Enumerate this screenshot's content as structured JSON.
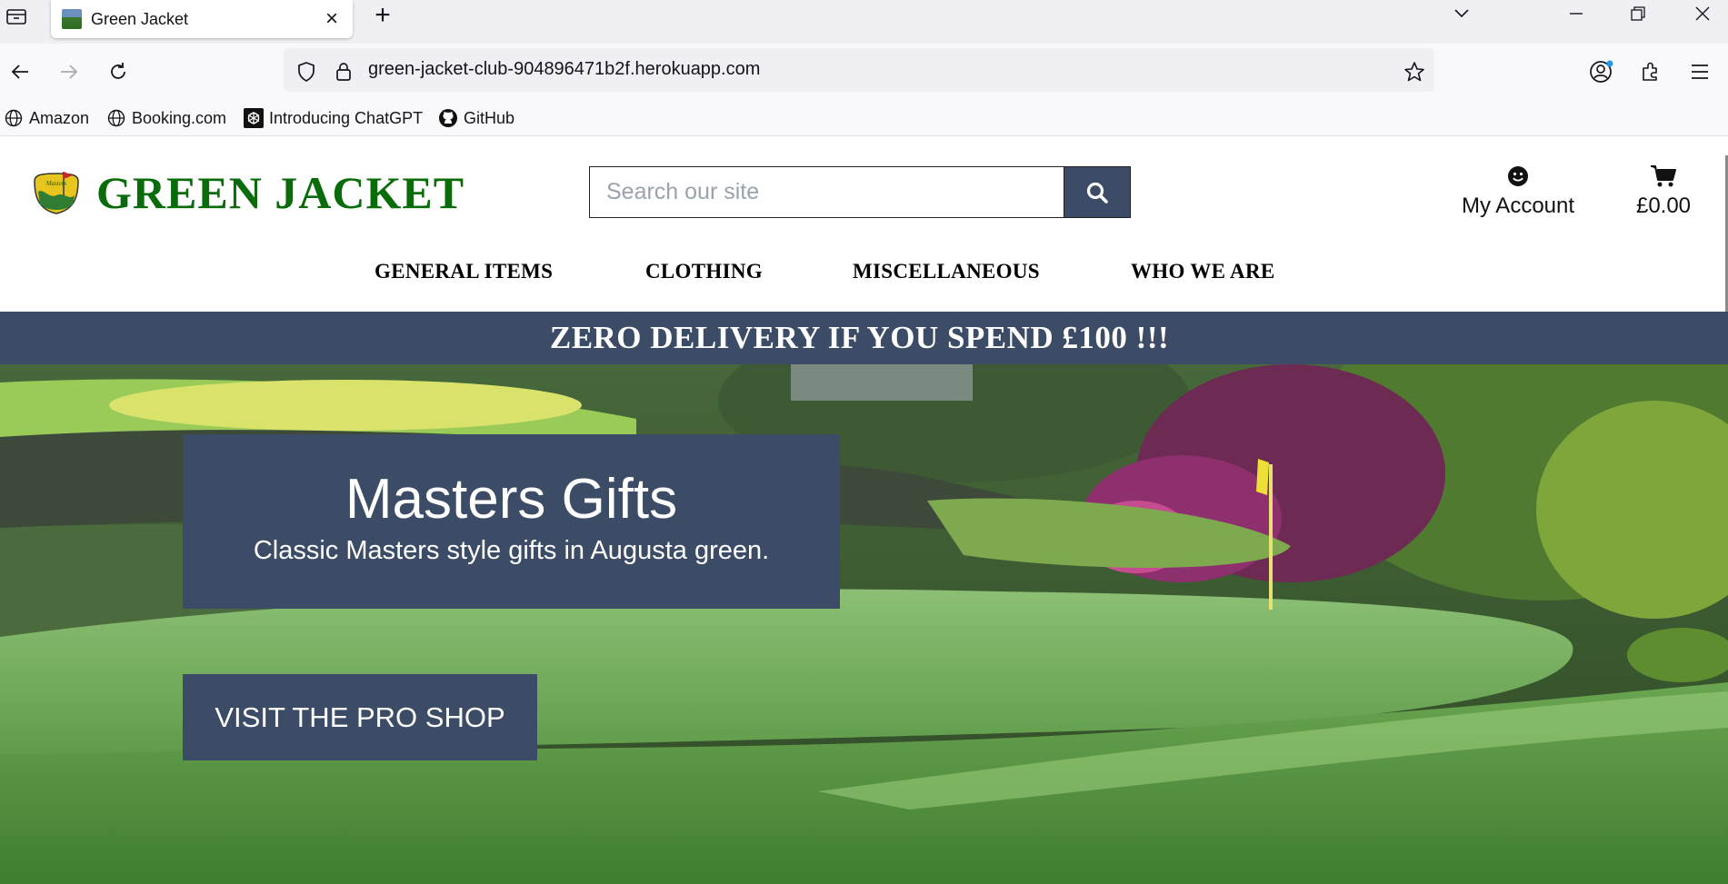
{
  "browser": {
    "tab_title": "Green Jacket",
    "url": "green-jacket-club-904896471b2f.herokuapp.com",
    "bookmarks": [
      {
        "label": "Amazon",
        "icon": "globe-icon"
      },
      {
        "label": "Booking.com",
        "icon": "globe-icon"
      },
      {
        "label": "Introducing ChatGPT",
        "icon": "openai-icon"
      },
      {
        "label": "GitHub",
        "icon": "github-icon"
      }
    ]
  },
  "site": {
    "brand": "GREEN JACKET",
    "search_placeholder": "Search our site",
    "account_label": "My Account",
    "cart_total": "£0.00",
    "nav": [
      "GENERAL ITEMS",
      "CLOTHING",
      "MISCELLANEOUS",
      "WHO WE ARE"
    ],
    "promo": "ZERO DELIVERY IF YOU SPEND £100 !!!",
    "hero": {
      "title": "Masters Gifts",
      "subtitle": "Classic Masters style gifts in Augusta green.",
      "cta": "VISIT THE PRO SHOP"
    }
  },
  "colors": {
    "brand_green": "#0a6b0a",
    "navy": "#3c4c66",
    "chrome_bg": "#f0f0f4"
  }
}
